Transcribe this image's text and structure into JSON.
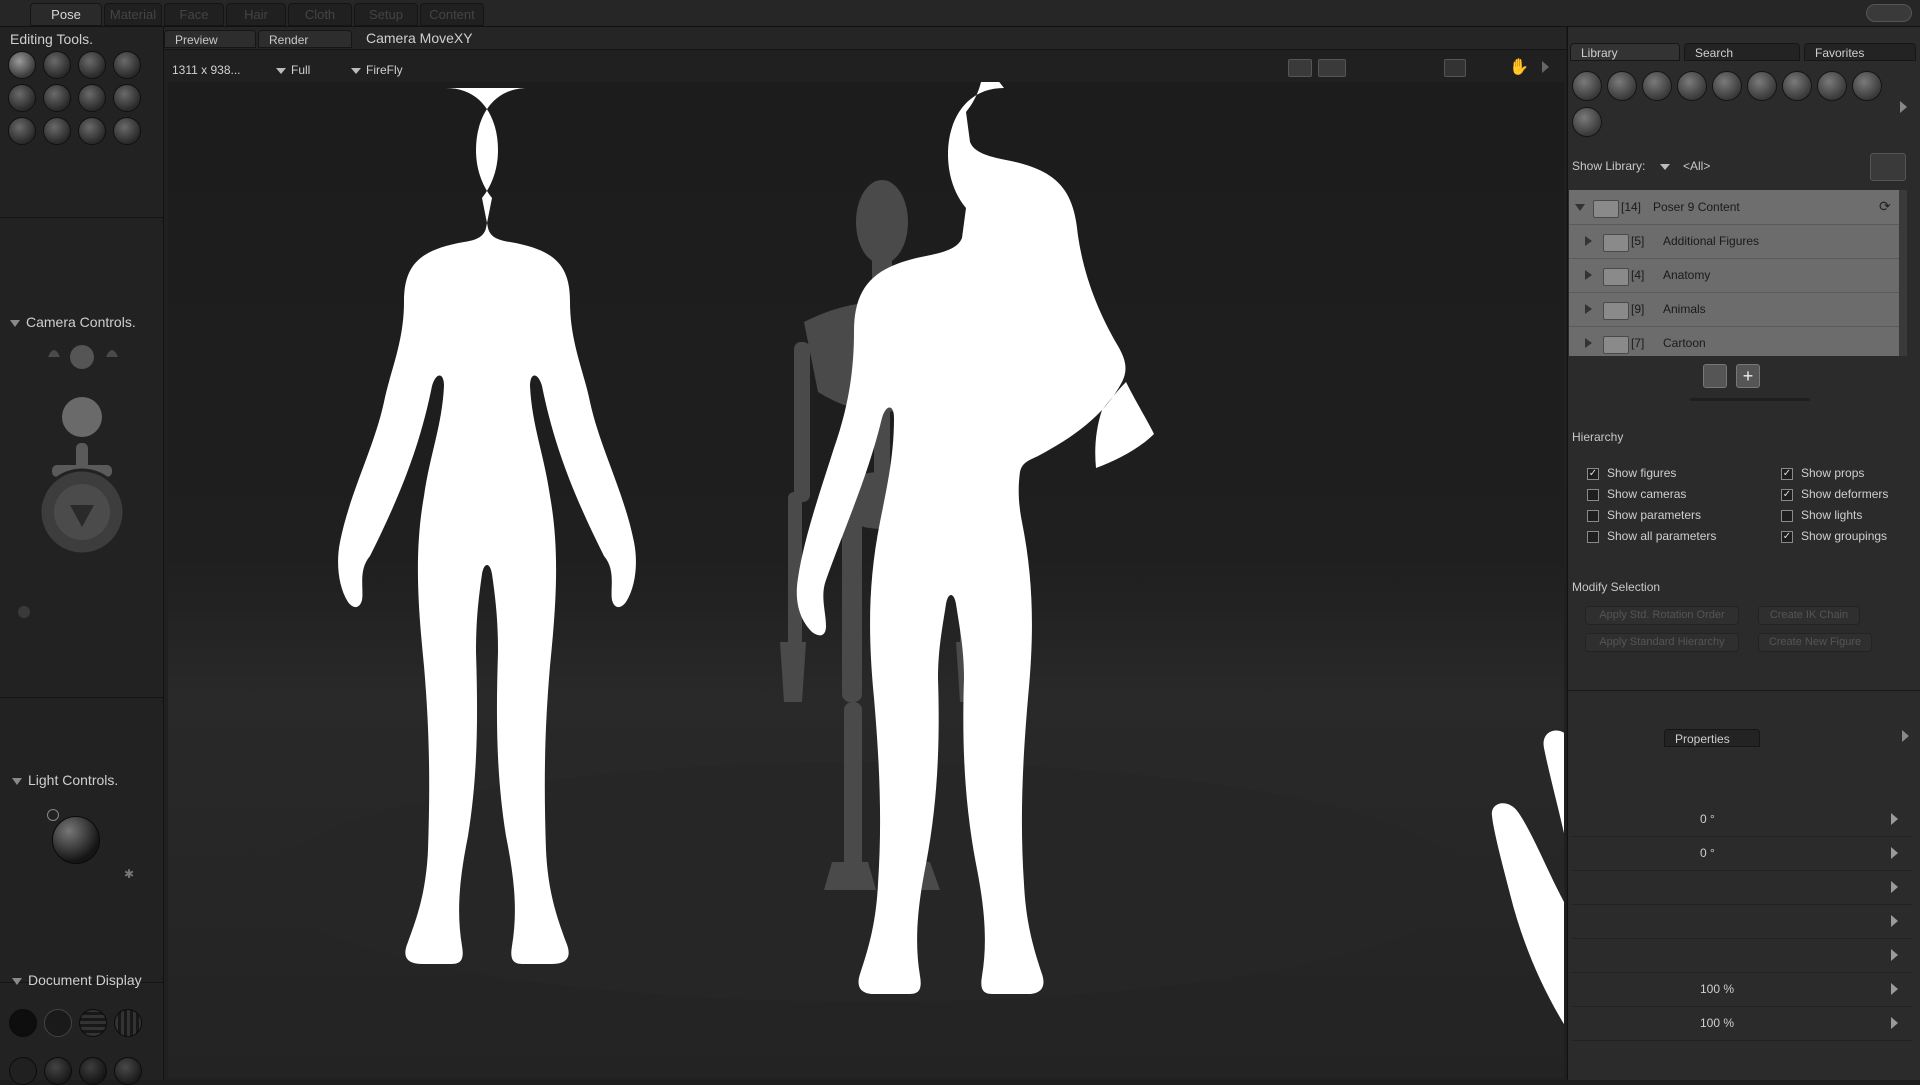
{
  "rooms": {
    "tabs": [
      "Pose",
      "Material",
      "Face",
      "Hair",
      "Cloth",
      "Setup",
      "Content"
    ],
    "active": "Pose"
  },
  "left_panel": {
    "editing_tools_title": "Editing Tools.",
    "camera_controls_title": "Camera Controls.",
    "light_controls_title": "Light Controls.",
    "document_display_title": "Document Display"
  },
  "viewport": {
    "tabs": {
      "preview": "Preview",
      "render": "Render"
    },
    "camera_title": "Camera MoveXY",
    "size": "1311 x 938...",
    "view_mode": "Full",
    "renderer": "FireFly"
  },
  "library": {
    "tabs": {
      "library": "Library",
      "search": "Search",
      "favorites": "Favorites"
    },
    "show_library_label": "Show Library:",
    "show_library_value": "<All>",
    "tree": {
      "root": {
        "count": "[14]",
        "label": "Poser 9 Content"
      },
      "items": [
        {
          "count": "[5]",
          "label": "Additional Figures"
        },
        {
          "count": "[4]",
          "label": "Anatomy"
        },
        {
          "count": "[9]",
          "label": "Animals"
        },
        {
          "count": "[7]",
          "label": "Cartoon"
        }
      ]
    }
  },
  "hierarchy": {
    "title": "Hierarchy",
    "options": [
      {
        "label": "Show figures",
        "checked": true
      },
      {
        "label": "Show props",
        "checked": true
      },
      {
        "label": "Show cameras",
        "checked": false
      },
      {
        "label": "Show deformers",
        "checked": true
      },
      {
        "label": "Show parameters",
        "checked": false
      },
      {
        "label": "Show lights",
        "checked": false
      },
      {
        "label": "Show all parameters",
        "checked": false
      },
      {
        "label": "Show groupings",
        "checked": true
      }
    ]
  },
  "modify_selection": {
    "title": "Modify Selection",
    "buttons": {
      "apply_rotation": "Apply Std. Rotation Order",
      "create_ik": "Create IK Chain",
      "apply_hierarchy": "Apply Standard Hierarchy",
      "create_figure": "Create New Figure"
    }
  },
  "parameters": {
    "properties_tab": "Properties",
    "values": [
      "0 °",
      "0 °",
      "100 %",
      "100 %"
    ]
  },
  "colors": {
    "accent_white": "#ffffff",
    "tree_bg": "#6c6c6c"
  }
}
